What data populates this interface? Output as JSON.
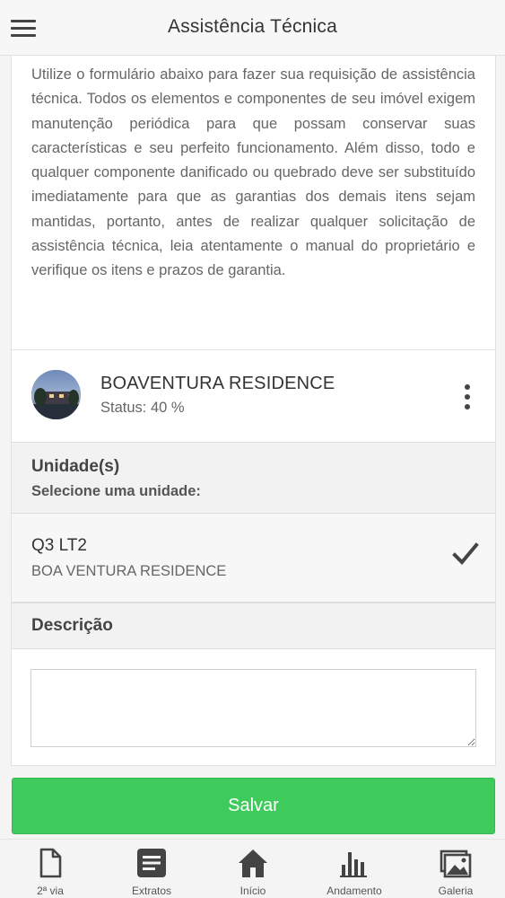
{
  "header": {
    "title": "Assistência Técnica"
  },
  "intro": {
    "text": "Utilize o formulário abaixo para fazer sua requisição de assistência técnica. Todos os elementos e componentes de seu imóvel exigem manutenção periódica para que possam conservar suas características e seu perfeito funcionamento. Além disso, todo e qualquer componente danificado ou quebrado deve ser substituído imediatamente para que as garantias dos demais itens sejam mantidas, portanto, antes de realizar qualquer solicitação de assistência técnica, leia atentamente o manual do proprietário e verifique os itens e prazos de garantia."
  },
  "project": {
    "name": "BOAVENTURA RESIDENCE",
    "status": "Status: 40 %"
  },
  "units": {
    "title": "Unidade(s)",
    "subtitle": "Selecione uma unidade:",
    "selected": {
      "name": "Q3 LT2",
      "project": "BOA VENTURA RESIDENCE"
    }
  },
  "description": {
    "title": "Descrição",
    "value": ""
  },
  "actions": {
    "save_label": "Salvar"
  },
  "bottom_nav": {
    "items": [
      {
        "label": "2ª via",
        "icon": "document-icon"
      },
      {
        "label": "Extratos",
        "icon": "list-document-icon"
      },
      {
        "label": "Início",
        "icon": "home-icon"
      },
      {
        "label": "Andamento",
        "icon": "bar-chart-icon"
      },
      {
        "label": "Galeria",
        "icon": "gallery-icon"
      }
    ]
  },
  "colors": {
    "accent_green": "#3ecb5c",
    "icon_gray": "#444444"
  }
}
